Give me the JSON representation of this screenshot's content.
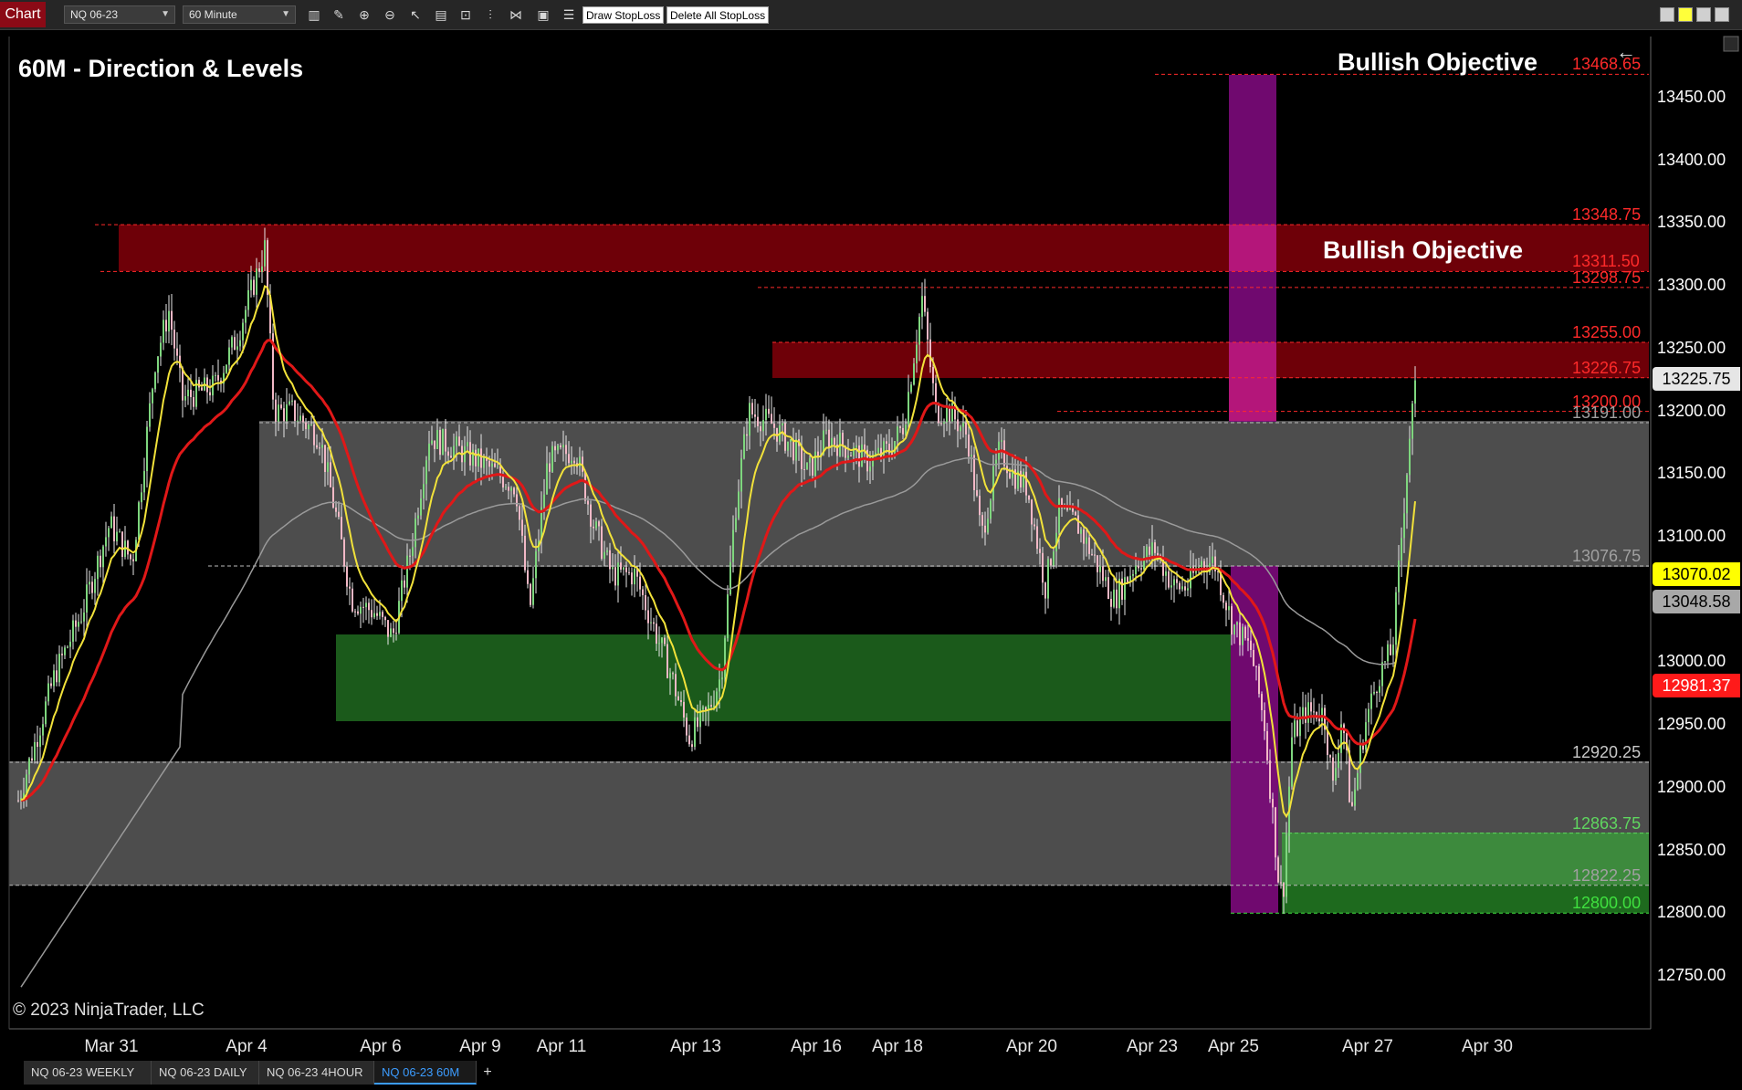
{
  "toolbar": {
    "chart_tab": "Chart",
    "instrument": "NQ 06-23",
    "interval": "60 Minute",
    "draw_stoploss": "Draw StopLoss",
    "delete_all_stoploss": "Delete All StopLoss",
    "icons": [
      "bar-style-icon",
      "pencil-icon",
      "zoom-in-icon",
      "zoom-out-icon",
      "pointer-icon",
      "data-box-icon",
      "properties-icon",
      "indicators-icon",
      "strategies-icon",
      "chart-trader-icon",
      "menu-icon"
    ],
    "colors": {
      "chart_tab": "#8b0a16"
    }
  },
  "chart": {
    "title": "60M - Direction & Levels",
    "copyright": "© 2023 NinjaTrader, LLC",
    "annotations": [
      "Bullish Objective",
      "Bullish Objective"
    ],
    "level_labels": [
      {
        "text": "13468.65",
        "value": 13468.65,
        "color": "#ff2a2a"
      },
      {
        "text": "13348.75",
        "value": 13348.75,
        "color": "#ff2a2a"
      },
      {
        "text": "13311.50",
        "value": 13311.5,
        "color": "#ff2a2a"
      },
      {
        "text": "13298.75",
        "value": 13298.75,
        "color": "#ff2a2a"
      },
      {
        "text": "13255.00",
        "value": 13255.0,
        "color": "#ff2a2a"
      },
      {
        "text": "13226.75",
        "value": 13226.75,
        "color": "#ff2a2a"
      },
      {
        "text": "13200.00",
        "value": 13200.0,
        "color": "#ff2a2a"
      },
      {
        "text": "13191.00",
        "value": 13191.0,
        "color": "#a0a0a0"
      },
      {
        "text": "13076.75",
        "value": 13076.75,
        "color": "#a0a0a0"
      },
      {
        "text": "12920.25",
        "value": 12920.25,
        "color": "#c8c8c8"
      },
      {
        "text": "12863.75",
        "value": 12863.75,
        "color": "#5fd65f"
      },
      {
        "text": "12822.25",
        "value": 12822.25,
        "color": "#a0a0a0"
      },
      {
        "text": "12800.00",
        "value": 12800.0,
        "color": "#3fe03f"
      }
    ],
    "price_axis": [
      "13450.00",
      "13400.00",
      "13350.00",
      "13300.00",
      "13250.00",
      "13200.00",
      "13150.00",
      "13100.00",
      "13050.00",
      "13000.00",
      "12950.00",
      "12900.00",
      "12850.00",
      "12800.00",
      "12750.00"
    ],
    "price_tags": [
      {
        "text": "13225.75",
        "bg": "#e6e6e6",
        "fg": "#000000",
        "value": 13225.75
      },
      {
        "text": "13070.02",
        "bg": "#ffff00",
        "fg": "#000000",
        "value": 13070.02
      },
      {
        "text": "13048.58",
        "bg": "#a8a8a8",
        "fg": "#000000",
        "value": 13048.58
      },
      {
        "text": "12981.37",
        "bg": "#ff1a1a",
        "fg": "#ffffff",
        "value": 12981.37
      }
    ],
    "dates": [
      "Mar 31",
      "Apr 4",
      "Apr 6",
      "Apr 9",
      "Apr 11",
      "Apr 13",
      "Apr 16",
      "Apr 18",
      "Apr 20",
      "Apr 23",
      "Apr 25",
      "Apr 27",
      "Apr 30"
    ],
    "colors": {
      "supply_zone": "#6e0008",
      "range_zone": "#4d4d4d",
      "demand_zone": "#1b5a1b",
      "target_zone": "#3d8a3d",
      "highlight_column": "#7a0a78",
      "ema_fast": "#f2e23a",
      "ema_slow": "#e01818",
      "sma_long": "#9a9a9a"
    }
  },
  "tabs": [
    "NQ 06-23 WEEKLY",
    "NQ 06-23 DAILY",
    "NQ 06-23 4HOUR",
    "NQ 06-23 60M"
  ],
  "active_tab": "NQ 06-23 60M"
}
